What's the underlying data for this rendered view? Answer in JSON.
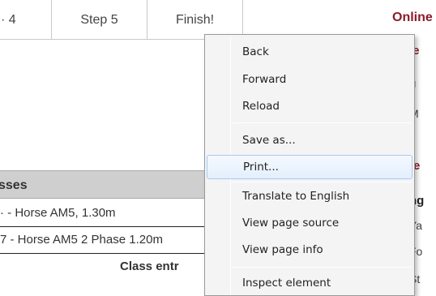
{
  "steps": [
    {
      "label": "· 4"
    },
    {
      "label": "Step 5"
    },
    {
      "label": "Finish!"
    }
  ],
  "online_title": "Online",
  "right_column": {
    "r1": "le",
    "r2": "J",
    "r3": "M",
    "r4": "2",
    "r5": "te",
    "r6": "ng",
    "r7": "Ya",
    "r8": "Fo",
    "r9": "St"
  },
  "classes": {
    "header": "sses",
    "rows": [
      "· - Horse AM5, 1.30m",
      "7 - Horse AM5 2 Phase 1.20m"
    ],
    "entry_label": "Class entr"
  },
  "context_menu": {
    "items": [
      {
        "label": "Back"
      },
      {
        "label": "Forward"
      },
      {
        "label": "Reload"
      },
      {
        "label": "Save as..."
      },
      {
        "label": "Print..."
      },
      {
        "label": "Translate to English"
      },
      {
        "label": "View page source"
      },
      {
        "label": "View page info"
      },
      {
        "label": "Inspect element"
      }
    ]
  }
}
